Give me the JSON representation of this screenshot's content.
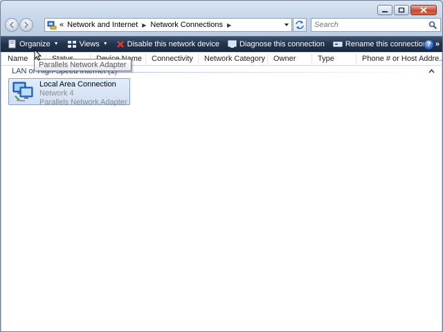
{
  "window": {
    "caption": {
      "minimize": "minimize",
      "maximize": "maximize",
      "close": "close"
    }
  },
  "address": {
    "prefix": "«",
    "crumbs": [
      "Network and Internet",
      "Network Connections"
    ]
  },
  "search": {
    "placeholder": "Search"
  },
  "toolbar": {
    "organize": "Organize",
    "views": "Views",
    "disable": "Disable this network device",
    "diagnose": "Diagnose this connection",
    "rename": "Rename this connection",
    "more": "»",
    "help": "?"
  },
  "columns": [
    "Name",
    "Status",
    "Device Name",
    "Connectivity",
    "Network Category",
    "Owner",
    "Type",
    "Phone # or Host Addre..."
  ],
  "group": {
    "title": "LAN or High-Speed Internet (1)"
  },
  "connection": {
    "name": "Local Area Connection",
    "network": "Network 4",
    "adapter": "Parallels Network Adapter"
  },
  "tooltip": {
    "text": "Parallels Network Adapter"
  },
  "colors": {
    "accent": "#1e3e9c",
    "toolbar": "#22344d",
    "selection": "#cfdff3"
  }
}
